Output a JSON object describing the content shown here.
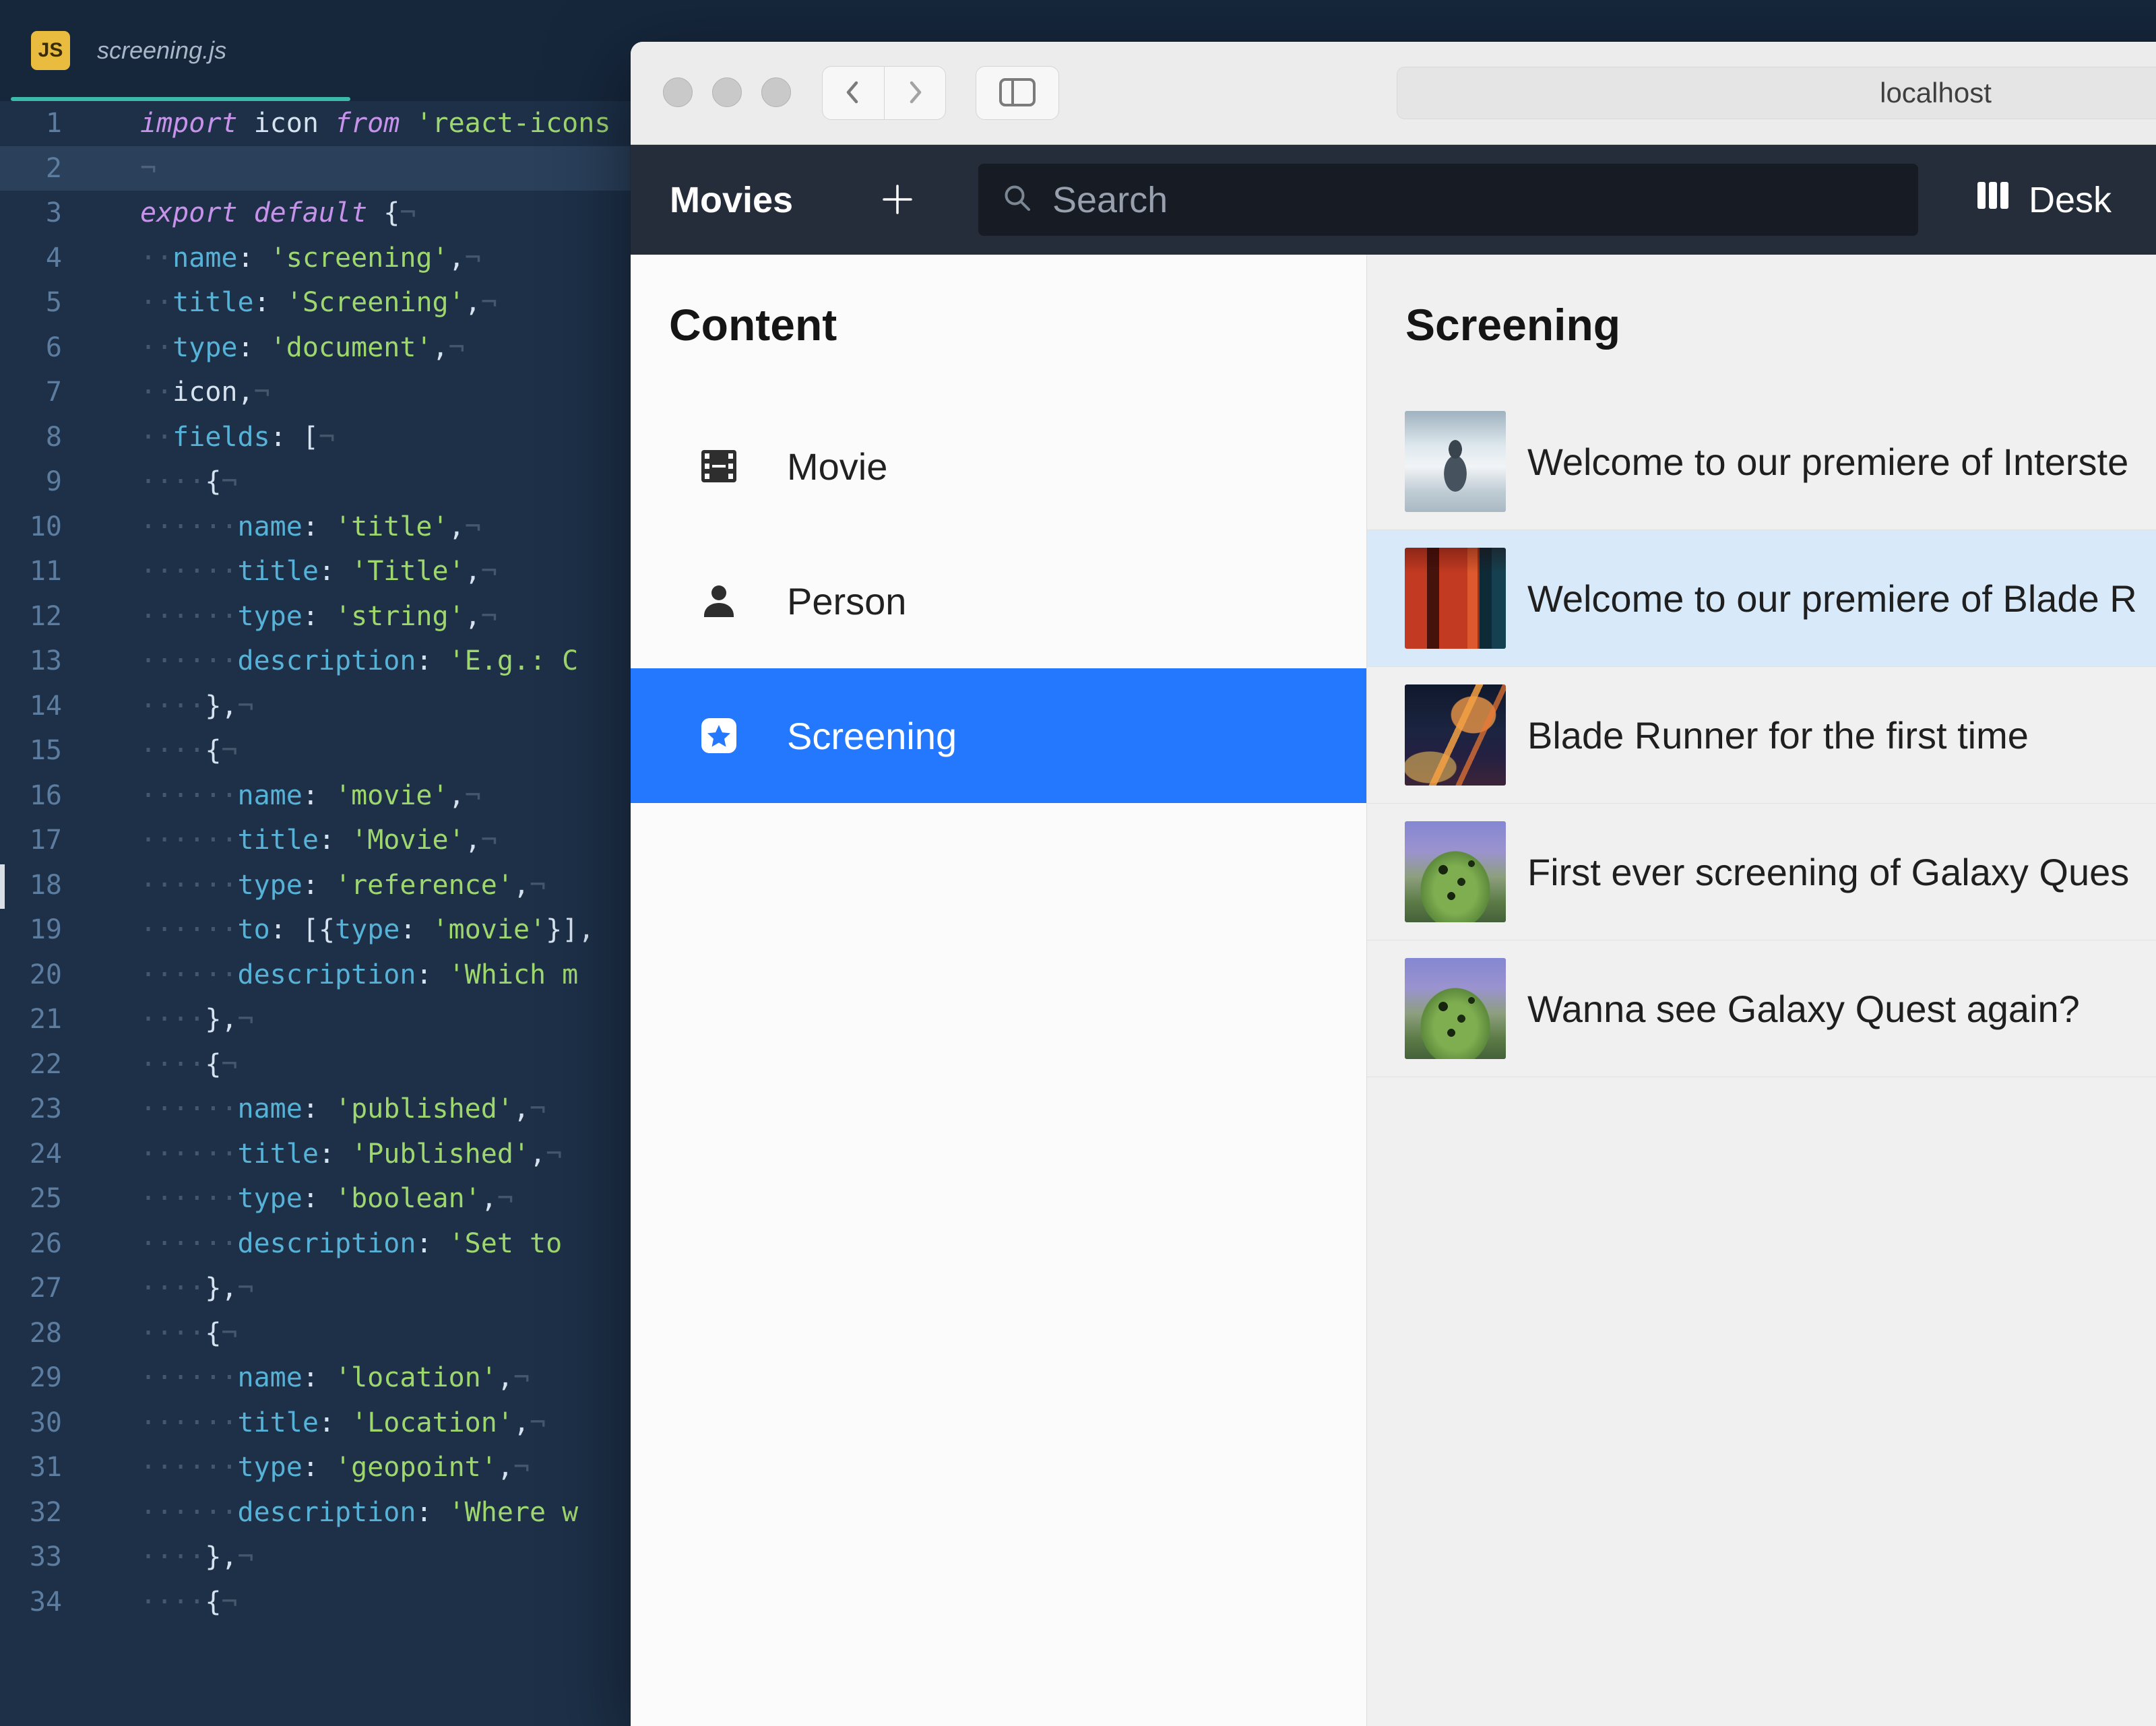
{
  "editor": {
    "tab": {
      "filename": "screening.js",
      "file_type_badge": "JS"
    },
    "active_line": 2,
    "lines": [
      {
        "n": 1,
        "t": [
          [
            "kw",
            "import"
          ],
          [
            "pl",
            " icon "
          ],
          [
            "kw",
            "from"
          ],
          [
            "pl",
            " "
          ],
          [
            "str",
            "'react-icons"
          ]
        ]
      },
      {
        "n": 2,
        "hl": true,
        "t": [
          [
            "ws",
            "¬"
          ]
        ]
      },
      {
        "n": 3,
        "t": [
          [
            "kw",
            "export"
          ],
          [
            "pl",
            " "
          ],
          [
            "kw",
            "default"
          ],
          [
            "pl",
            " "
          ],
          [
            "p",
            "{"
          ],
          [
            "ws",
            "¬"
          ]
        ]
      },
      {
        "n": 4,
        "t": [
          [
            "ws",
            "··"
          ],
          [
            "key",
            "name"
          ],
          [
            "p",
            ":"
          ],
          [
            "pl",
            " "
          ],
          [
            "str",
            "'screening'"
          ],
          [
            "p",
            ","
          ],
          [
            "ws",
            "¬"
          ]
        ]
      },
      {
        "n": 5,
        "t": [
          [
            "ws",
            "··"
          ],
          [
            "key",
            "title"
          ],
          [
            "p",
            ":"
          ],
          [
            "pl",
            " "
          ],
          [
            "str",
            "'Screening'"
          ],
          [
            "p",
            ","
          ],
          [
            "ws",
            "¬"
          ]
        ]
      },
      {
        "n": 6,
        "t": [
          [
            "ws",
            "··"
          ],
          [
            "key",
            "type"
          ],
          [
            "p",
            ":"
          ],
          [
            "pl",
            " "
          ],
          [
            "str",
            "'document'"
          ],
          [
            "p",
            ","
          ],
          [
            "ws",
            "¬"
          ]
        ]
      },
      {
        "n": 7,
        "t": [
          [
            "ws",
            "··"
          ],
          [
            "pl",
            "icon"
          ],
          [
            "p",
            ","
          ],
          [
            "ws",
            "¬"
          ]
        ]
      },
      {
        "n": 8,
        "t": [
          [
            "ws",
            "··"
          ],
          [
            "key",
            "fields"
          ],
          [
            "p",
            ":"
          ],
          [
            "pl",
            " "
          ],
          [
            "p",
            "["
          ],
          [
            "ws",
            "¬"
          ]
        ]
      },
      {
        "n": 9,
        "t": [
          [
            "ws",
            "····"
          ],
          [
            "p",
            "{"
          ],
          [
            "ws",
            "¬"
          ]
        ]
      },
      {
        "n": 10,
        "t": [
          [
            "ws",
            "······"
          ],
          [
            "key",
            "name"
          ],
          [
            "p",
            ":"
          ],
          [
            "pl",
            " "
          ],
          [
            "str",
            "'title'"
          ],
          [
            "p",
            ","
          ],
          [
            "ws",
            "¬"
          ]
        ]
      },
      {
        "n": 11,
        "t": [
          [
            "ws",
            "······"
          ],
          [
            "key",
            "title"
          ],
          [
            "p",
            ":"
          ],
          [
            "pl",
            " "
          ],
          [
            "str",
            "'Title'"
          ],
          [
            "p",
            ","
          ],
          [
            "ws",
            "¬"
          ]
        ]
      },
      {
        "n": 12,
        "t": [
          [
            "ws",
            "······"
          ],
          [
            "key",
            "type"
          ],
          [
            "p",
            ":"
          ],
          [
            "pl",
            " "
          ],
          [
            "str",
            "'string'"
          ],
          [
            "p",
            ","
          ],
          [
            "ws",
            "¬"
          ]
        ]
      },
      {
        "n": 13,
        "t": [
          [
            "ws",
            "······"
          ],
          [
            "key",
            "description"
          ],
          [
            "p",
            ":"
          ],
          [
            "pl",
            " "
          ],
          [
            "str",
            "'E.g.: C"
          ]
        ]
      },
      {
        "n": 14,
        "t": [
          [
            "ws",
            "····"
          ],
          [
            "p",
            "},"
          ],
          [
            "ws",
            "¬"
          ]
        ]
      },
      {
        "n": 15,
        "t": [
          [
            "ws",
            "····"
          ],
          [
            "p",
            "{"
          ],
          [
            "ws",
            "¬"
          ]
        ]
      },
      {
        "n": 16,
        "t": [
          [
            "ws",
            "······"
          ],
          [
            "key",
            "name"
          ],
          [
            "p",
            ":"
          ],
          [
            "pl",
            " "
          ],
          [
            "str",
            "'movie'"
          ],
          [
            "p",
            ","
          ],
          [
            "ws",
            "¬"
          ]
        ]
      },
      {
        "n": 17,
        "t": [
          [
            "ws",
            "······"
          ],
          [
            "key",
            "title"
          ],
          [
            "p",
            ":"
          ],
          [
            "pl",
            " "
          ],
          [
            "str",
            "'Movie'"
          ],
          [
            "p",
            ","
          ],
          [
            "ws",
            "¬"
          ]
        ]
      },
      {
        "n": 18,
        "t": [
          [
            "ws",
            "······"
          ],
          [
            "key",
            "type"
          ],
          [
            "p",
            ":"
          ],
          [
            "pl",
            " "
          ],
          [
            "str",
            "'reference'"
          ],
          [
            "p",
            ","
          ],
          [
            "ws",
            "¬"
          ]
        ]
      },
      {
        "n": 19,
        "t": [
          [
            "ws",
            "······"
          ],
          [
            "key",
            "to"
          ],
          [
            "p",
            ":"
          ],
          [
            "pl",
            " "
          ],
          [
            "p",
            "[{"
          ],
          [
            "key",
            "type"
          ],
          [
            "p",
            ":"
          ],
          [
            "pl",
            " "
          ],
          [
            "str",
            "'movie'"
          ],
          [
            "p",
            "}],"
          ]
        ]
      },
      {
        "n": 20,
        "t": [
          [
            "ws",
            "······"
          ],
          [
            "key",
            "description"
          ],
          [
            "p",
            ":"
          ],
          [
            "pl",
            " "
          ],
          [
            "str",
            "'Which m"
          ]
        ]
      },
      {
        "n": 21,
        "t": [
          [
            "ws",
            "····"
          ],
          [
            "p",
            "},"
          ],
          [
            "ws",
            "¬"
          ]
        ]
      },
      {
        "n": 22,
        "t": [
          [
            "ws",
            "····"
          ],
          [
            "p",
            "{"
          ],
          [
            "ws",
            "¬"
          ]
        ]
      },
      {
        "n": 23,
        "t": [
          [
            "ws",
            "······"
          ],
          [
            "key",
            "name"
          ],
          [
            "p",
            ":"
          ],
          [
            "pl",
            " "
          ],
          [
            "str",
            "'published'"
          ],
          [
            "p",
            ","
          ],
          [
            "ws",
            "¬"
          ]
        ]
      },
      {
        "n": 24,
        "t": [
          [
            "ws",
            "······"
          ],
          [
            "key",
            "title"
          ],
          [
            "p",
            ":"
          ],
          [
            "pl",
            " "
          ],
          [
            "str",
            "'Published'"
          ],
          [
            "p",
            ","
          ],
          [
            "ws",
            "¬"
          ]
        ]
      },
      {
        "n": 25,
        "t": [
          [
            "ws",
            "······"
          ],
          [
            "key",
            "type"
          ],
          [
            "p",
            ":"
          ],
          [
            "pl",
            " "
          ],
          [
            "str",
            "'boolean'"
          ],
          [
            "p",
            ","
          ],
          [
            "ws",
            "¬"
          ]
        ]
      },
      {
        "n": 26,
        "t": [
          [
            "ws",
            "······"
          ],
          [
            "key",
            "description"
          ],
          [
            "p",
            ":"
          ],
          [
            "pl",
            " "
          ],
          [
            "str",
            "'Set to "
          ]
        ]
      },
      {
        "n": 27,
        "t": [
          [
            "ws",
            "····"
          ],
          [
            "p",
            "},"
          ],
          [
            "ws",
            "¬"
          ]
        ]
      },
      {
        "n": 28,
        "t": [
          [
            "ws",
            "····"
          ],
          [
            "p",
            "{"
          ],
          [
            "ws",
            "¬"
          ]
        ]
      },
      {
        "n": 29,
        "t": [
          [
            "ws",
            "······"
          ],
          [
            "key",
            "name"
          ],
          [
            "p",
            ":"
          ],
          [
            "pl",
            " "
          ],
          [
            "str",
            "'location'"
          ],
          [
            "p",
            ","
          ],
          [
            "ws",
            "¬"
          ]
        ]
      },
      {
        "n": 30,
        "t": [
          [
            "ws",
            "······"
          ],
          [
            "key",
            "title"
          ],
          [
            "p",
            ":"
          ],
          [
            "pl",
            " "
          ],
          [
            "str",
            "'Location'"
          ],
          [
            "p",
            ","
          ],
          [
            "ws",
            "¬"
          ]
        ]
      },
      {
        "n": 31,
        "t": [
          [
            "ws",
            "······"
          ],
          [
            "key",
            "type"
          ],
          [
            "p",
            ":"
          ],
          [
            "pl",
            " "
          ],
          [
            "str",
            "'geopoint'"
          ],
          [
            "p",
            ","
          ],
          [
            "ws",
            "¬"
          ]
        ]
      },
      {
        "n": 32,
        "t": [
          [
            "ws",
            "······"
          ],
          [
            "key",
            "description"
          ],
          [
            "p",
            ":"
          ],
          [
            "pl",
            " "
          ],
          [
            "str",
            "'Where w"
          ]
        ]
      },
      {
        "n": 33,
        "t": [
          [
            "ws",
            "····"
          ],
          [
            "p",
            "},"
          ],
          [
            "ws",
            "¬"
          ]
        ]
      },
      {
        "n": 34,
        "t": [
          [
            "ws",
            "····"
          ],
          [
            "p",
            "{"
          ],
          [
            "ws",
            "¬"
          ]
        ]
      }
    ]
  },
  "browser": {
    "url": "localhost",
    "navbar": {
      "title": "Movies",
      "search_placeholder": "Search",
      "desk_label": "Desk"
    },
    "content_pane": {
      "heading": "Content",
      "items": [
        {
          "label": "Movie",
          "icon": "film-icon",
          "icon_key": "film",
          "selected": false
        },
        {
          "label": "Person",
          "icon": "person-icon",
          "icon_key": "person",
          "selected": false
        },
        {
          "label": "Screening",
          "icon": "star-badge-icon",
          "icon_key": "star",
          "selected": true
        }
      ]
    },
    "documents_pane": {
      "heading": "Screening",
      "items": [
        {
          "title": "Welcome to our premiere of Interste",
          "thumb": "interstellar",
          "selected": false
        },
        {
          "title": "Welcome to our premiere of Blade R",
          "thumb": "blade-runner-2049",
          "selected": true
        },
        {
          "title": "Blade Runner for the first time",
          "thumb": "blade-runner",
          "selected": false
        },
        {
          "title": "First ever screening of Galaxy Ques",
          "thumb": "galaxy-quest",
          "selected": false
        },
        {
          "title": "Wanna see Galaxy Quest again?",
          "thumb": "galaxy-quest-2",
          "selected": false
        }
      ]
    }
  },
  "colors": {
    "accent_blue": "#2478fd",
    "selected_document_row": "#d8eaf9",
    "tab_underline_teal": "#3cb9a9",
    "js_badge_amber": "#e9bb3f",
    "editor_background": "#1d3048",
    "studio_navbar": "#262d3a"
  }
}
